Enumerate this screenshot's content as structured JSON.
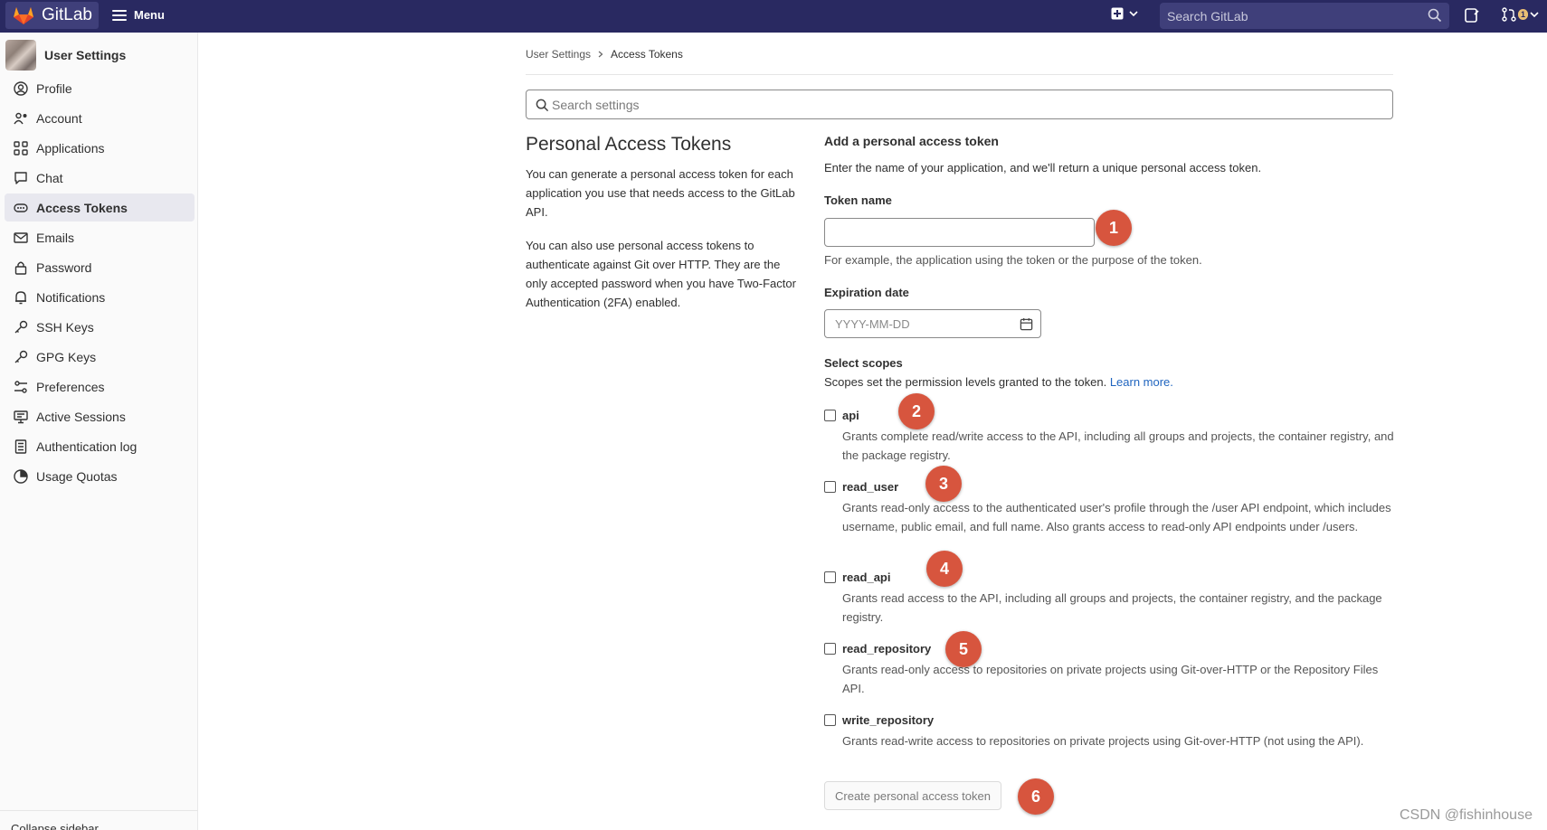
{
  "navbar": {
    "brand": "GitLab",
    "menu_label": "Menu",
    "search_placeholder": "Search GitLab",
    "mr_count": "1"
  },
  "sidebar": {
    "title": "User Settings",
    "items": [
      {
        "label": "Profile",
        "icon": "profile-icon"
      },
      {
        "label": "Account",
        "icon": "account-icon"
      },
      {
        "label": "Applications",
        "icon": "applications-icon"
      },
      {
        "label": "Chat",
        "icon": "chat-icon"
      },
      {
        "label": "Access Tokens",
        "icon": "token-icon",
        "active": true
      },
      {
        "label": "Emails",
        "icon": "mail-icon"
      },
      {
        "label": "Password",
        "icon": "lock-icon"
      },
      {
        "label": "Notifications",
        "icon": "bell-icon"
      },
      {
        "label": "SSH Keys",
        "icon": "key-icon"
      },
      {
        "label": "GPG Keys",
        "icon": "key-icon"
      },
      {
        "label": "Preferences",
        "icon": "preferences-icon"
      },
      {
        "label": "Active Sessions",
        "icon": "monitor-icon"
      },
      {
        "label": "Authentication log",
        "icon": "log-icon"
      },
      {
        "label": "Usage Quotas",
        "icon": "quota-icon"
      }
    ],
    "collapse_label": "Collapse sidebar"
  },
  "breadcrumb": {
    "parent": "User Settings",
    "current": "Access Tokens"
  },
  "settings_search": {
    "placeholder": "Search settings"
  },
  "intro": {
    "heading": "Personal Access Tokens",
    "para1": "You can generate a personal access token for each application you use that needs access to the GitLab API.",
    "para2": "You can also use personal access tokens to authenticate against Git over HTTP. They are the only accepted password when you have Two-Factor Authentication (2FA) enabled."
  },
  "form": {
    "title": "Add a personal access token",
    "intro": "Enter the name of your application, and we'll return a unique personal access token.",
    "token_name_label": "Token name",
    "token_name_value": "",
    "token_name_help": "For example, the application using the token or the purpose of the token.",
    "expiration_label": "Expiration date",
    "expiration_placeholder": "YYYY-MM-DD",
    "scopes_label": "Select scopes",
    "scopes_help": "Scopes set the permission levels granted to the token.",
    "learn_more": "Learn more.",
    "scopes": [
      {
        "name": "api",
        "desc": "Grants complete read/write access to the API, including all groups and projects, the container registry, and the package registry.",
        "checked": false
      },
      {
        "name": "read_user",
        "desc": "Grants read-only access to the authenticated user's profile through the /user API endpoint, which includes username, public email, and full name. Also grants access to read-only API endpoints under /users.",
        "checked": false
      },
      {
        "name": "read_api",
        "desc": "Grants read access to the API, including all groups and projects, the container registry, and the package registry.",
        "checked": false
      },
      {
        "name": "read_repository",
        "desc": "Grants read-only access to repositories on private projects using Git-over-HTTP or the Repository Files API.",
        "checked": false
      },
      {
        "name": "write_repository",
        "desc": "Grants read-write access to repositories on private projects using Git-over-HTTP (not using the API).",
        "checked": false
      }
    ],
    "submit_label": "Create personal access token"
  },
  "annotations": [
    "1",
    "2",
    "3",
    "4",
    "5",
    "6"
  ],
  "annotation_color": "#d7553e",
  "watermark": "CSDN @fishinhouse"
}
